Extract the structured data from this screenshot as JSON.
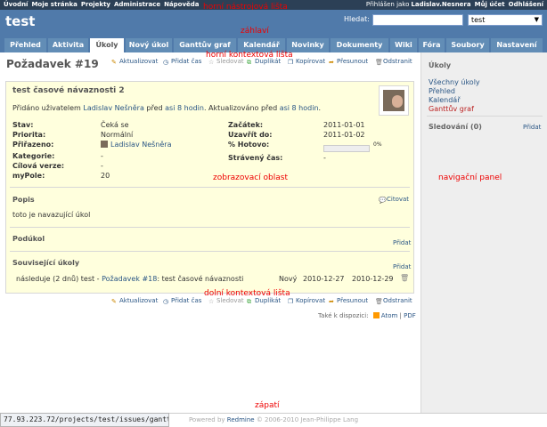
{
  "top_menu": {
    "left": [
      "Úvodní",
      "Moje stránka",
      "Projekty",
      "Administrace",
      "Nápověda"
    ],
    "logged_as": "Přihlášen jako",
    "user": "Ladislav.Nesnera",
    "my_account": "Můj účet",
    "logout": "Odhlášení"
  },
  "header": {
    "project_title": "test",
    "search_label": "Hledat:",
    "search_value": "",
    "project_select": "test"
  },
  "tabs": [
    "Přehled",
    "Aktivita",
    "Úkoly",
    "Nový úkol",
    "Ganttův graf",
    "Kalendář",
    "Novinky",
    "Dokumenty",
    "Wiki",
    "Fóra",
    "Soubory",
    "Nastavení"
  ],
  "labels": {
    "top_toolbar": "horní nástrojová lišta",
    "header": "záhlaví",
    "top_context": "horní kontextová lišta",
    "display_area": "zobrazovací oblast",
    "nav_panel": "navigační panel",
    "bottom_context": "dolní kontextová lišta",
    "footer": "zápatí"
  },
  "page_title": "Požadavek #19",
  "contextual": [
    "Aktualizovat",
    "Přidat čas",
    "Sledovat",
    "Duplikát",
    "Kopírovat",
    "Přesunout",
    "Odstranit"
  ],
  "issue": {
    "subject": "test časové návaznosti 2",
    "added_by": "Přidáno uživatelem",
    "author": "Ladislav Nešněra",
    "before": "před",
    "age": "asi 8 hodin",
    "updated": ". Aktualizováno před",
    "updated_age": "asi 8 hodin",
    "left_fields": [
      [
        "Stav:",
        "Čeká se"
      ],
      [
        "Priorita:",
        "Normální"
      ],
      [
        "Přiřazeno:",
        "Ladislav Nešněra"
      ],
      [
        "Kategorie:",
        "-"
      ],
      [
        "Cílová verze:",
        "-"
      ],
      [
        "myPole:",
        "20"
      ]
    ],
    "right_fields": [
      [
        "Začátek:",
        "2011-01-01"
      ],
      [
        "Uzavřít do:",
        "2011-01-02"
      ],
      [
        "% Hotovo:",
        "0%"
      ],
      [
        "Strávený čas:",
        "-"
      ]
    ],
    "done_percent": 0,
    "description_title": "Popis",
    "quote": "Citovat",
    "description": "toto je navazující úkol",
    "subtasks_title": "Podúkol",
    "add": "Přidat",
    "related_title": "Související úkoly",
    "related": {
      "prefix": "následuje (2 dnů) test -",
      "link": "Požadavek #18",
      "rest": ": test časové návaznosti",
      "status": "Nový",
      "start": "2010-12-27",
      "end": "2010-12-29"
    }
  },
  "other_formats": {
    "label": "Také k dispozici:",
    "atom": "Atom",
    "sep": "|",
    "pdf": "PDF"
  },
  "sidebar": {
    "issues_title": "Úkoly",
    "items": [
      "Všechny úkoly",
      "Přehled",
      "Kalendář",
      "Ganttův graf"
    ],
    "watchers": "Sledování (0)",
    "watchers_add": "Přidat"
  },
  "footer": {
    "text": "Powered by",
    "brand": "Redmine",
    "copy": "© 2006-2010 Jean-Philippe Lang"
  },
  "statusbar": "77.93.223.72/projects/test/issues/gantt"
}
